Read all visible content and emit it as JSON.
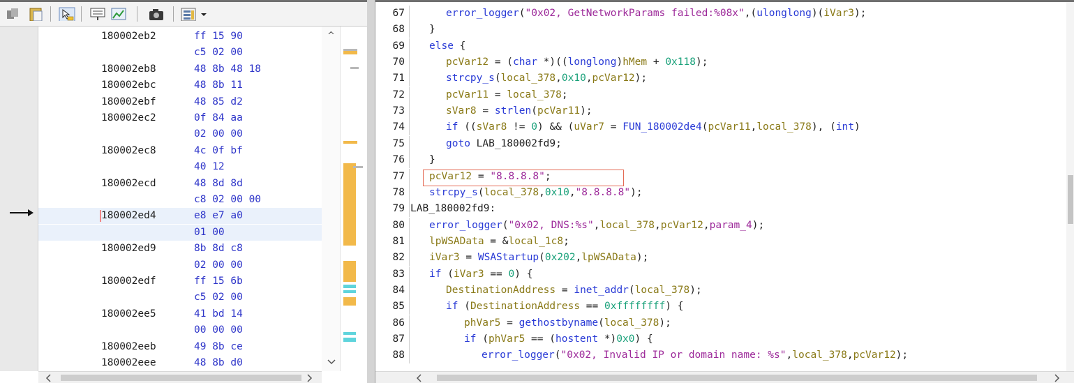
{
  "toolbar": {
    "icons": [
      "copy-icon",
      "paste-icon",
      "cursor-select-icon",
      "display-bytes-icon",
      "diff-view-icon",
      "snapshot-icon",
      "field-layout-icon",
      "dropdown-arrow-icon"
    ]
  },
  "listing": {
    "rows": [
      {
        "addr": "180002eb2",
        "bytes": "ff 15 90"
      },
      {
        "addr": "",
        "bytes": "c5 02 00"
      },
      {
        "addr": "180002eb8",
        "bytes": "48 8b 48 18"
      },
      {
        "addr": "180002ebc",
        "bytes": "48 8b 11"
      },
      {
        "addr": "180002ebf",
        "bytes": "48 85 d2"
      },
      {
        "addr": "180002ec2",
        "bytes": "0f 84 aa"
      },
      {
        "addr": "",
        "bytes": "02 00 00"
      },
      {
        "addr": "180002ec8",
        "bytes": "4c 0f bf"
      },
      {
        "addr": "",
        "bytes": "40 12"
      },
      {
        "addr": "180002ecd",
        "bytes": "48 8d 8d"
      },
      {
        "addr": "",
        "bytes": "c8 02 00 00"
      },
      {
        "addr": "180002ed4",
        "bytes": "e8 e7 a0"
      },
      {
        "addr": "",
        "bytes": "01 00"
      },
      {
        "addr": "180002ed9",
        "bytes": "8b 8d c8"
      },
      {
        "addr": "",
        "bytes": "02 00 00"
      },
      {
        "addr": "180002edf",
        "bytes": "ff 15 6b"
      },
      {
        "addr": "",
        "bytes": "c5 02 00"
      },
      {
        "addr": "180002ee5",
        "bytes": "41 bd 14"
      },
      {
        "addr": "",
        "bytes": "00 00 00"
      },
      {
        "addr": "180002eeb",
        "bytes": "49 8b ce"
      },
      {
        "addr": "180002eee",
        "bytes": "48 8b d0"
      }
    ],
    "current_address": "180002ed4"
  },
  "decompiler": {
    "lines": [
      {
        "n": "67",
        "indent": 2,
        "tokens": [
          [
            "f",
            "error_logger"
          ],
          [
            "p",
            "("
          ],
          [
            "s",
            "\"0x02, GetNetworkParams failed:%08x\""
          ],
          [
            "p",
            ",("
          ],
          [
            "k",
            "ulonglong"
          ],
          [
            "p",
            ")("
          ],
          [
            "v",
            "iVar3"
          ],
          [
            "p",
            ");"
          ]
        ]
      },
      {
        "n": "68",
        "indent": 1,
        "tokens": [
          [
            "p",
            "}"
          ]
        ]
      },
      {
        "n": "69",
        "indent": 1,
        "tokens": [
          [
            "k",
            "else"
          ],
          [
            "p",
            " {"
          ]
        ]
      },
      {
        "n": "70",
        "indent": 2,
        "tokens": [
          [
            "v",
            "pcVar12"
          ],
          [
            "p",
            " = ("
          ],
          [
            "k",
            "char"
          ],
          [
            "p",
            " *)(("
          ],
          [
            "k",
            "longlong"
          ],
          [
            "p",
            ")"
          ],
          [
            "v",
            "hMem"
          ],
          [
            "p",
            " + "
          ],
          [
            "n",
            "0x118"
          ],
          [
            "p",
            ");"
          ]
        ]
      },
      {
        "n": "71",
        "indent": 2,
        "tokens": [
          [
            "f",
            "strcpy_s"
          ],
          [
            "p",
            "("
          ],
          [
            "v",
            "local_378"
          ],
          [
            "p",
            ","
          ],
          [
            "n",
            "0x10"
          ],
          [
            "p",
            ","
          ],
          [
            "v",
            "pcVar12"
          ],
          [
            "p",
            ");"
          ]
        ]
      },
      {
        "n": "72",
        "indent": 2,
        "tokens": [
          [
            "v",
            "pcVar11"
          ],
          [
            "p",
            " = "
          ],
          [
            "v",
            "local_378"
          ],
          [
            "p",
            ";"
          ]
        ]
      },
      {
        "n": "73",
        "indent": 2,
        "tokens": [
          [
            "v",
            "sVar8"
          ],
          [
            "p",
            " = "
          ],
          [
            "f",
            "strlen"
          ],
          [
            "p",
            "("
          ],
          [
            "v",
            "pcVar11"
          ],
          [
            "p",
            ");"
          ]
        ]
      },
      {
        "n": "74",
        "indent": 2,
        "tokens": [
          [
            "k",
            "if"
          ],
          [
            "p",
            " (("
          ],
          [
            "v",
            "sVar8"
          ],
          [
            "p",
            " != "
          ],
          [
            "n",
            "0"
          ],
          [
            "p",
            ") && ("
          ],
          [
            "v",
            "uVar7"
          ],
          [
            "p",
            " = "
          ],
          [
            "f",
            "FUN_180002de4"
          ],
          [
            "p",
            "("
          ],
          [
            "v",
            "pcVar11"
          ],
          [
            "p",
            ","
          ],
          [
            "v",
            "local_378"
          ],
          [
            "p",
            "), ("
          ],
          [
            "k",
            "int"
          ],
          [
            "p",
            ")"
          ]
        ]
      },
      {
        "n": "75",
        "indent": 2,
        "tokens": [
          [
            "k",
            "goto"
          ],
          [
            "p",
            " LAB_180002fd9;"
          ]
        ]
      },
      {
        "n": "76",
        "indent": 1,
        "tokens": [
          [
            "p",
            "}"
          ]
        ]
      },
      {
        "n": "77",
        "indent": 0,
        "tokens": [
          [
            "v",
            "pcVar12"
          ],
          [
            "p",
            " = "
          ],
          [
            "s",
            "\"8.8.8.8\""
          ],
          [
            "p",
            ";"
          ]
        ]
      },
      {
        "n": "78",
        "indent": 1,
        "tokens": [
          [
            "f",
            "strcpy_s"
          ],
          [
            "p",
            "("
          ],
          [
            "v",
            "local_378"
          ],
          [
            "p",
            ","
          ],
          [
            "n",
            "0x10"
          ],
          [
            "p",
            ","
          ],
          [
            "s",
            "\"8.8.8.8\""
          ],
          [
            "p",
            ");"
          ]
        ]
      },
      {
        "n": "79",
        "indent": -1,
        "tokens": [
          [
            "p",
            "LAB_180002fd9:"
          ]
        ]
      },
      {
        "n": "80",
        "indent": 1,
        "tokens": [
          [
            "f",
            "error_logger"
          ],
          [
            "p",
            "("
          ],
          [
            "s",
            "\"0x02, DNS:%s\""
          ],
          [
            "p",
            ","
          ],
          [
            "v",
            "local_378"
          ],
          [
            "p",
            ","
          ],
          [
            "v",
            "pcVar12"
          ],
          [
            "p",
            ","
          ],
          [
            "s",
            "param_4"
          ],
          [
            "p",
            ");"
          ]
        ]
      },
      {
        "n": "81",
        "indent": 1,
        "tokens": [
          [
            "v",
            "lpWSAData"
          ],
          [
            "p",
            " = &"
          ],
          [
            "v",
            "local_1c8"
          ],
          [
            "p",
            ";"
          ]
        ]
      },
      {
        "n": "82",
        "indent": 1,
        "tokens": [
          [
            "v",
            "iVar3"
          ],
          [
            "p",
            " = "
          ],
          [
            "f",
            "WSAStartup"
          ],
          [
            "p",
            "("
          ],
          [
            "n",
            "0x202"
          ],
          [
            "p",
            ","
          ],
          [
            "v",
            "lpWSAData"
          ],
          [
            "p",
            ");"
          ]
        ]
      },
      {
        "n": "83",
        "indent": 1,
        "tokens": [
          [
            "k",
            "if"
          ],
          [
            "p",
            " ("
          ],
          [
            "v",
            "iVar3"
          ],
          [
            "p",
            " == "
          ],
          [
            "n",
            "0"
          ],
          [
            "p",
            ") {"
          ]
        ]
      },
      {
        "n": "84",
        "indent": 2,
        "tokens": [
          [
            "v",
            "DestinationAddress"
          ],
          [
            "p",
            " = "
          ],
          [
            "f",
            "inet_addr"
          ],
          [
            "p",
            "("
          ],
          [
            "v",
            "local_378"
          ],
          [
            "p",
            ");"
          ]
        ]
      },
      {
        "n": "85",
        "indent": 2,
        "tokens": [
          [
            "k",
            "if"
          ],
          [
            "p",
            " ("
          ],
          [
            "v",
            "DestinationAddress"
          ],
          [
            "p",
            " == "
          ],
          [
            "n",
            "0xffffffff"
          ],
          [
            "p",
            ") {"
          ]
        ]
      },
      {
        "n": "86",
        "indent": 3,
        "tokens": [
          [
            "v",
            "phVar5"
          ],
          [
            "p",
            " = "
          ],
          [
            "f",
            "gethostbyname"
          ],
          [
            "p",
            "("
          ],
          [
            "v",
            "local_378"
          ],
          [
            "p",
            ");"
          ]
        ]
      },
      {
        "n": "87",
        "indent": 3,
        "tokens": [
          [
            "k",
            "if"
          ],
          [
            "p",
            " ("
          ],
          [
            "v",
            "phVar5"
          ],
          [
            "p",
            " == ("
          ],
          [
            "k",
            "hostent"
          ],
          [
            "p",
            " *)"
          ],
          [
            "n",
            "0x0"
          ],
          [
            "p",
            ") {"
          ]
        ]
      },
      {
        "n": "88",
        "indent": 4,
        "tokens": [
          [
            "f",
            "error_logger"
          ],
          [
            "p",
            "("
          ],
          [
            "s",
            "\"0x02, Invalid IP or domain name: %s\""
          ],
          [
            "p",
            ","
          ],
          [
            "v",
            "local_378"
          ],
          [
            "p",
            ","
          ],
          [
            "v",
            "pcVar12"
          ],
          [
            "p",
            ");"
          ]
        ]
      }
    ],
    "highlighted_line": "77"
  },
  "colors": {
    "keyword": "#2a3bd6",
    "variable": "#8a7a18",
    "number": "#1aa17a",
    "string": "#9d2a9a",
    "highlight_box": "#e46b55",
    "overview_orange": "#f2b94a",
    "overview_cyan": "#5fd4dc"
  },
  "scroll": {
    "left_up": "^",
    "left_down": "v",
    "left_left": "<",
    "left_right": ">",
    "right_left": "<",
    "right_right": ">"
  }
}
